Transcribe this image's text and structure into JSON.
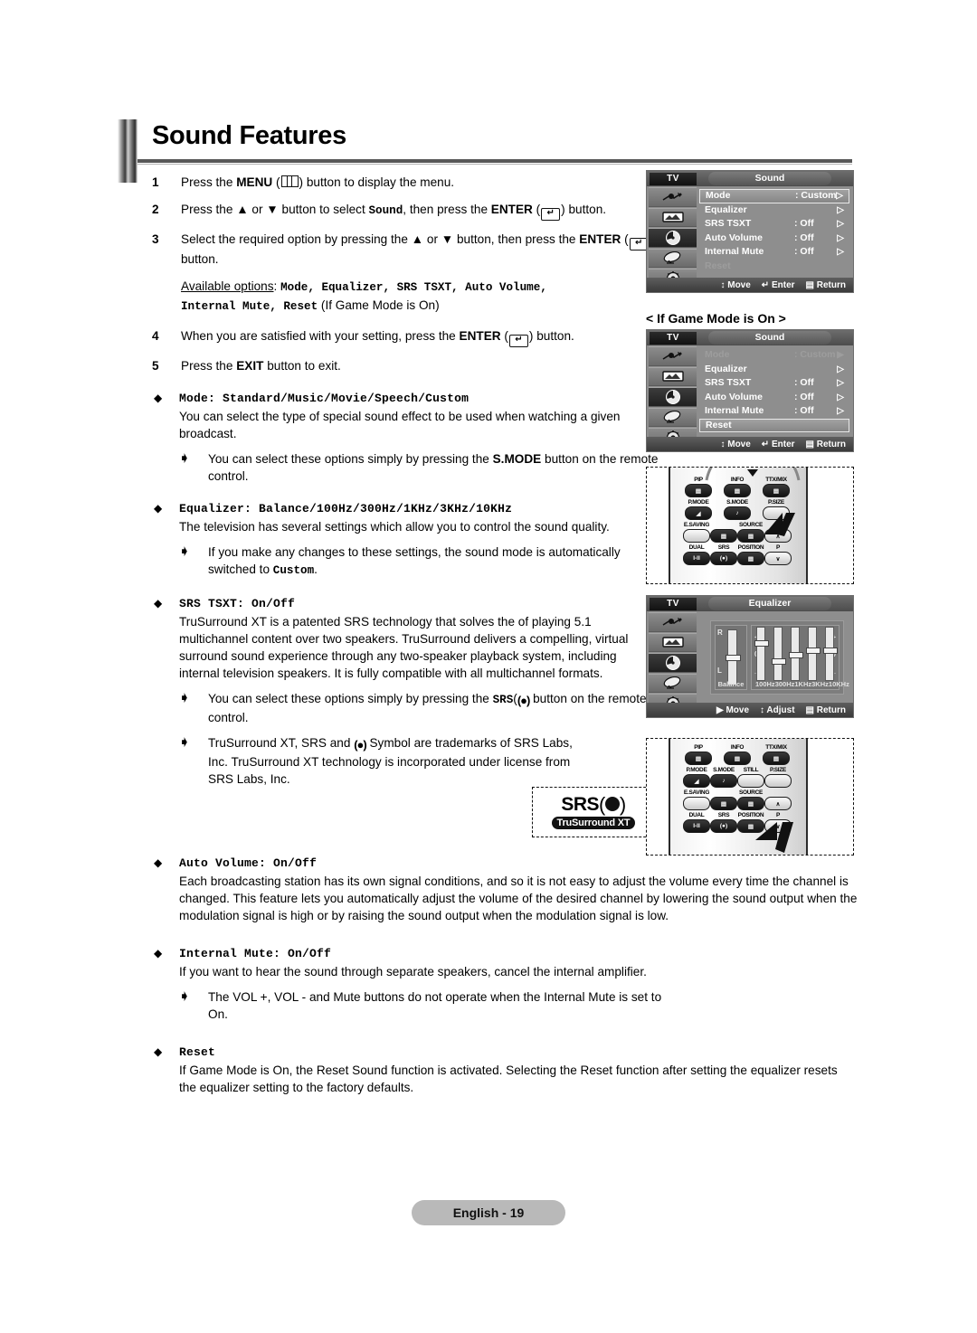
{
  "page": {
    "title": "Sound Features",
    "footer": "English - 19"
  },
  "steps": [
    {
      "num": "1",
      "pre": "Press the ",
      "bold": "MENU",
      "mid": " (",
      "icon": "menu-icon",
      "post": ") button to display the menu."
    },
    {
      "num": "2",
      "text_a": "Press the ▲ or ▼ button to select ",
      "mono_a": "Sound",
      "text_b": ", then press the ",
      "bold_b": "ENTER",
      "text_c": " (",
      "icon": "enter-icon",
      "text_d": ") button."
    },
    {
      "num": "3",
      "text_a": "Select the required option by pressing the ▲ or ▼ button, then press the ",
      "bold_b": "ENTER",
      "text_c": " (",
      "icon": "enter-icon",
      "text_d": ") button."
    },
    {
      "num": "4",
      "text_a": "When you are satisfied with your setting, press the ",
      "bold_b": "ENTER",
      "text_c": " (",
      "icon": "enter-icon",
      "text_d": ") button."
    },
    {
      "num": "5",
      "text_a": "Press the ",
      "bold_b": "EXIT",
      "text_c": " button to exit."
    }
  ],
  "available_options": {
    "label": "Available options",
    "colon": ": ",
    "line1_items": "Mode, Equalizer, SRS TSXT, Auto Volume,",
    "line2_items": "Internal Mute, Reset",
    "line2_tail": " (If Game Mode is On)"
  },
  "sections": [
    {
      "key": "mode",
      "heading_label": "Mode",
      "heading_sep": ": ",
      "heading_values": "Standard/Music/Movie/Speech/Custom",
      "body": "You can select the type of special sound effect to be used when watching a given broadcast.",
      "notes": [
        {
          "text_a": "You can select these options simply by pressing the ",
          "bold": "S.MODE",
          "text_b": " button on the remote control."
        }
      ]
    },
    {
      "key": "equalizer",
      "heading_label": "Equalizer",
      "heading_sep": ": ",
      "heading_values": "Balance/100Hz/300Hz/1KHz/3KHz/10KHz",
      "body": "The television has several settings which allow you to control the sound quality.",
      "notes": [
        {
          "text_a": "If you make any changes to these settings, the sound mode is automatically switched to ",
          "mono": "Custom",
          "text_b": "."
        }
      ]
    },
    {
      "key": "srs_tsxt",
      "heading_label": "SRS TSXT",
      "heading_sep": ": ",
      "heading_values": "On/Off",
      "body": "TruSurround XT is a patented SRS technology that solves the of playing 5.1 multichannel content over two speakers. TruSurround delivers a compelling, virtual surround sound experience through any two-speaker playback system, including internal television speakers. It is fully compatible with all multichannel formats.",
      "notes": [
        {
          "text_a": "You can select these options simply by pressing the ",
          "mono": "SRS",
          "symbol": "(●)",
          "text_b": " button on the remote control."
        },
        {
          "text_a": "TruSurround XT, SRS and ",
          "symbol": "(●)",
          "text_b": " Symbol are trademarks of SRS Labs, Inc. TruSurround XT technology is incorporated under license from SRS Labs, Inc."
        }
      ]
    },
    {
      "key": "auto_volume",
      "heading_label": "Auto Volume",
      "heading_sep": ": ",
      "heading_values": "On/Off",
      "body": "Each broadcasting station has its own signal conditions, and so it is not easy to adjust the volume every time the channel is changed. This feature lets you automatically adjust the volume of the desired channel by lowering the sound output when the modulation signal is high or by raising the sound output when the modulation signal is low.",
      "notes": []
    },
    {
      "key": "internal_mute",
      "heading_label": "Internal Mute",
      "heading_sep": ": ",
      "heading_values": "On/Off",
      "body": "If you want to hear the sound through separate speakers, cancel the internal amplifier.",
      "notes": [
        {
          "text_a": "The VOL +, VOL - and Mute buttons do not operate when the Internal Mute is set to On."
        }
      ]
    },
    {
      "key": "reset",
      "heading_label": "Reset",
      "heading_sep": "",
      "heading_values": "",
      "body": "If Game Mode is On, the Reset Sound function is activated. Selecting the Reset function after setting the equalizer resets the equalizer setting to the factory defaults.",
      "notes": []
    }
  ],
  "srs_logo": {
    "brand": "SRS",
    "tagline": "TruSurround XT"
  },
  "game_mode_label": "< If Game Mode is On >",
  "osd_menus": [
    {
      "id": "sound-menu",
      "tv_label": "TV",
      "title": "Sound",
      "rows": [
        {
          "label": "Mode",
          "value": ": Custom",
          "arrow": "▷",
          "state": "highlight"
        },
        {
          "label": "Equalizer",
          "value": "",
          "arrow": "▷",
          "state": "normal"
        },
        {
          "label": "SRS TSXT",
          "value": ": Off",
          "arrow": "▷",
          "state": "normal"
        },
        {
          "label": "Auto Volume",
          "value": ": Off",
          "arrow": "▷",
          "state": "normal"
        },
        {
          "label": "Internal Mute",
          "value": ": Off",
          "arrow": "▷",
          "state": "normal"
        },
        {
          "label": "Reset",
          "value": "",
          "arrow": "",
          "state": "dim"
        }
      ],
      "hints": [
        {
          "icon": "updown-icon",
          "label": "Move"
        },
        {
          "icon": "enter-icon",
          "label": "Enter"
        },
        {
          "icon": "menu-icon",
          "label": "Return"
        }
      ]
    },
    {
      "id": "sound-menu-game",
      "tv_label": "TV",
      "title": "Sound",
      "rows": [
        {
          "label": "Mode",
          "value": ": Custom",
          "arrow": "▶",
          "state": "dim"
        },
        {
          "label": "Equalizer",
          "value": "",
          "arrow": "▷",
          "state": "normal"
        },
        {
          "label": "SRS TSXT",
          "value": ": Off",
          "arrow": "▷",
          "state": "normal"
        },
        {
          "label": "Auto Volume",
          "value": ": Off",
          "arrow": "▷",
          "state": "normal"
        },
        {
          "label": "Internal Mute",
          "value": ": Off",
          "arrow": "▷",
          "state": "normal"
        },
        {
          "label": "Reset",
          "value": "",
          "arrow": "",
          "state": "highlight"
        }
      ],
      "hints": [
        {
          "icon": "updown-icon",
          "label": "Move"
        },
        {
          "icon": "enter-icon",
          "label": "Enter"
        },
        {
          "icon": "menu-icon",
          "label": "Return"
        }
      ]
    }
  ],
  "equalizer_osd": {
    "id": "equalizer-menu",
    "tv_label": "TV",
    "title": "Equalizer",
    "balance": {
      "top_label": "R",
      "bottom_label": "L",
      "name": "Balance"
    },
    "bands": [
      "100Hz",
      "300Hz",
      "1KHz",
      "3KHz",
      "10KHz"
    ],
    "scale": {
      "plus": "+",
      "zero": "0",
      "minus": "_"
    },
    "hints": [
      {
        "icon": "right-arrow-icon",
        "label": "Move"
      },
      {
        "icon": "updown-icon",
        "label": "Adjust"
      },
      {
        "icon": "menu-icon",
        "label": "Return"
      }
    ]
  },
  "remotes": [
    {
      "id": "remote-smode",
      "highlight": "S.MODE",
      "rows": [
        [
          {
            "label": "PIP",
            "glyph": "▤"
          },
          {
            "label": "INFO",
            "glyph": "▤"
          },
          {
            "label": "TTX/MIX",
            "glyph": "▤"
          }
        ],
        [
          {
            "label": "P.MODE",
            "glyph": "◢"
          },
          {
            "label": "S.MODE",
            "glyph": "♪"
          },
          {
            "label": "P.SIZE",
            "glyph": ""
          }
        ],
        [
          {
            "label": "E.SAVING",
            "glyph": ""
          },
          {
            "label": "",
            "glyph": "▤"
          },
          {
            "label": "SOURCE",
            "glyph": "▤"
          },
          {
            "label": "",
            "glyph": "∧"
          }
        ],
        [
          {
            "label": "DUAL",
            "glyph": "I-II"
          },
          {
            "label": "SRS",
            "glyph": "(●)"
          },
          {
            "label": "POSITION",
            "glyph": "▤"
          },
          {
            "label": "P",
            "glyph": "∨"
          }
        ]
      ]
    },
    {
      "id": "remote-srs",
      "highlight": "SRS",
      "rows": [
        [
          {
            "label": "PIP",
            "glyph": "▤"
          },
          {
            "label": "INFO",
            "glyph": "▤"
          },
          {
            "label": "TTX/MIX",
            "glyph": "▤"
          }
        ],
        [
          {
            "label": "P.MODE",
            "glyph": "◢"
          },
          {
            "label": "S.MODE",
            "glyph": "♪"
          },
          {
            "label": "STILL",
            "glyph": ""
          },
          {
            "label": "P.SIZE",
            "glyph": ""
          }
        ],
        [
          {
            "label": "E.SAVING",
            "glyph": ""
          },
          {
            "label": "",
            "glyph": "▤"
          },
          {
            "label": "SOURCE",
            "glyph": "▤"
          },
          {
            "label": "",
            "glyph": "∧"
          }
        ],
        [
          {
            "label": "DUAL",
            "glyph": "I-II"
          },
          {
            "label": "SRS",
            "glyph": "(●)"
          },
          {
            "label": "POSITION",
            "glyph": "▤"
          },
          {
            "label": "P",
            "glyph": "∨"
          }
        ]
      ]
    }
  ],
  "colors": {
    "osd_bg": "#8e8e8e",
    "osd_text": "#ffffff",
    "osd_dim": "#9d9d9d",
    "footer_bg": "#b9b9b9",
    "rule": "#585858"
  }
}
